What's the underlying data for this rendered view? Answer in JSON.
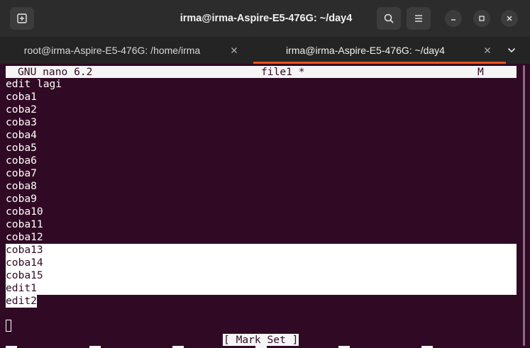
{
  "window": {
    "title": "irma@irma-Aspire-E5-476G: ~/day4"
  },
  "tabs": [
    {
      "label": "root@irma-Aspire-E5-476G: /home/irma",
      "active": false
    },
    {
      "label": "irma@irma-Aspire-E5-476G: ~/day4",
      "active": true
    }
  ],
  "icons": {
    "new_tab": "new-tab-icon",
    "search": "search-icon",
    "menu": "hamburger-icon",
    "minimize": "minimize-icon",
    "maximize": "maximize-icon",
    "close": "close-icon",
    "tab_close": "close-icon",
    "tab_list": "chevron-down-icon"
  },
  "colors": {
    "terminal_bg": "#300a24",
    "titlebar_bg": "#2c2c2c",
    "active_tab_accent": "#e95420",
    "highlight": "#f5f5f5"
  },
  "nano": {
    "version": "GNU nano 6.2",
    "filename": "file1 *",
    "modified_flag": "M",
    "lines": [
      "edit lagi",
      "coba1",
      "coba2",
      "coba3",
      "coba4",
      "coba5",
      "coba6",
      "coba7",
      "coba8",
      "coba9",
      "coba10",
      "coba11",
      "coba12",
      "coba13",
      "coba14",
      "coba15",
      "edit1",
      "edit2"
    ],
    "selected_from_line": "coba13",
    "status_message": "[ Mark Set ]"
  }
}
